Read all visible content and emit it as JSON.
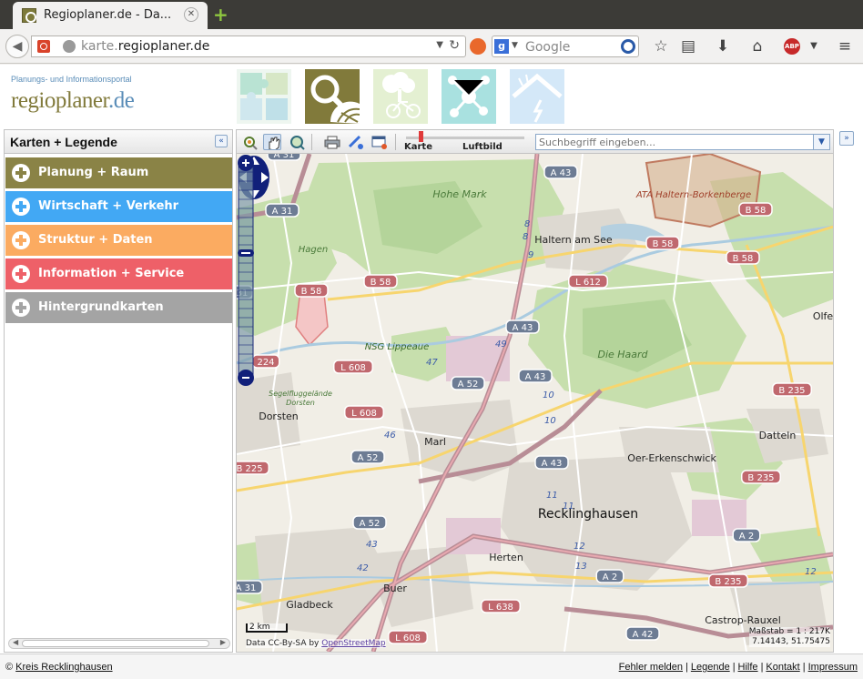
{
  "browser": {
    "tab_title": "Regioplaner.de - Da...",
    "url_domain": "karte.",
    "url_host": "regioplaner.de",
    "search_placeholder": "Google"
  },
  "header": {
    "portal_subtitle": "Planungs- und Informationsportal",
    "logo_main": "regioplaner",
    "logo_tld": ".de"
  },
  "sidebar": {
    "title": "Karten + Legende",
    "categories": [
      {
        "label": "Planung + Raum",
        "color": "#8a8346"
      },
      {
        "label": "Wirtschaft + Verkehr",
        "color": "#42a8f4"
      },
      {
        "label": "Struktur + Daten",
        "color": "#fbab61"
      },
      {
        "label": "Information + Service",
        "color": "#ee6068"
      },
      {
        "label": "Hintergrundkarten",
        "color": "#a4a4a4"
      }
    ]
  },
  "map": {
    "layer_karte": "Karte",
    "layer_luftbild": "Luftbild",
    "search_placeholder": "Suchbegriff eingeben...",
    "scale_label": "2 km",
    "attribution_prefix": "Data CC-By-SA by",
    "attribution_link": "OpenStreetMap",
    "scale_text": "Maßstab = 1 : 217K",
    "coordinates": "7.14143, 51.75475",
    "places": [
      {
        "name": "Hohe Mark"
      },
      {
        "name": "ATA Haltern-Borkenberge"
      },
      {
        "name": "Haltern am See"
      },
      {
        "name": "Hagen"
      },
      {
        "name": "NSG Lippeaue"
      },
      {
        "name": "Die Haard"
      },
      {
        "name": "Segelfluggelände Dorsten"
      },
      {
        "name": "Dorsten"
      },
      {
        "name": "Marl"
      },
      {
        "name": "Oer-Erkenschwick"
      },
      {
        "name": "Datteln"
      },
      {
        "name": "Olfe"
      },
      {
        "name": "Recklinghausen"
      },
      {
        "name": "Herten"
      },
      {
        "name": "Gladbeck"
      },
      {
        "name": "Buer"
      },
      {
        "name": "Castrop-Rauxel"
      }
    ],
    "road_shields": [
      {
        "label": "A 31",
        "type": "motorway"
      },
      {
        "label": "A 43",
        "type": "motorway"
      },
      {
        "label": "A 31",
        "type": "motorway"
      },
      {
        "label": "B 58",
        "type": "federal"
      },
      {
        "label": "B 58",
        "type": "federal"
      },
      {
        "label": "B 58",
        "type": "federal"
      },
      {
        "label": "B 58",
        "type": "federal"
      },
      {
        "label": "B 58",
        "type": "federal"
      },
      {
        "label": "L 612",
        "type": "federal"
      },
      {
        "label": "A 43",
        "type": "motorway"
      },
      {
        "label": "L 608",
        "type": "federal"
      },
      {
        "label": "A 52",
        "type": "motorway"
      },
      {
        "label": "A 43",
        "type": "motorway"
      },
      {
        "label": "B 235",
        "type": "federal"
      },
      {
        "label": "L 608",
        "type": "federal"
      },
      {
        "label": "A 52",
        "type": "motorway"
      },
      {
        "label": "A 43",
        "type": "motorway"
      },
      {
        "label": "B 225",
        "type": "federal"
      },
      {
        "label": "B 235",
        "type": "federal"
      },
      {
        "label": "A 52",
        "type": "motorway"
      },
      {
        "label": "A 2",
        "type": "motorway"
      },
      {
        "label": "A 2",
        "type": "motorway"
      },
      {
        "label": "B 235",
        "type": "federal"
      },
      {
        "label": "L 638",
        "type": "federal"
      },
      {
        "label": "A 42",
        "type": "motorway"
      },
      {
        "label": "L 608",
        "type": "federal"
      },
      {
        "label": "A 31",
        "type": "motorway"
      },
      {
        "label": "31",
        "type": "motorway"
      },
      {
        "label": "224",
        "type": "federal"
      }
    ],
    "exit_numbers": [
      "8",
      "8",
      "9",
      "49",
      "47",
      "10",
      "10",
      "11",
      "11",
      "12",
      "13",
      "46",
      "43",
      "42",
      "12"
    ]
  },
  "footer": {
    "copyright": "© ",
    "copyright_link": "Kreis Recklinghausen",
    "links": [
      "Fehler melden",
      "Legende",
      "Hilfe",
      "Kontakt",
      "Impressum"
    ]
  }
}
